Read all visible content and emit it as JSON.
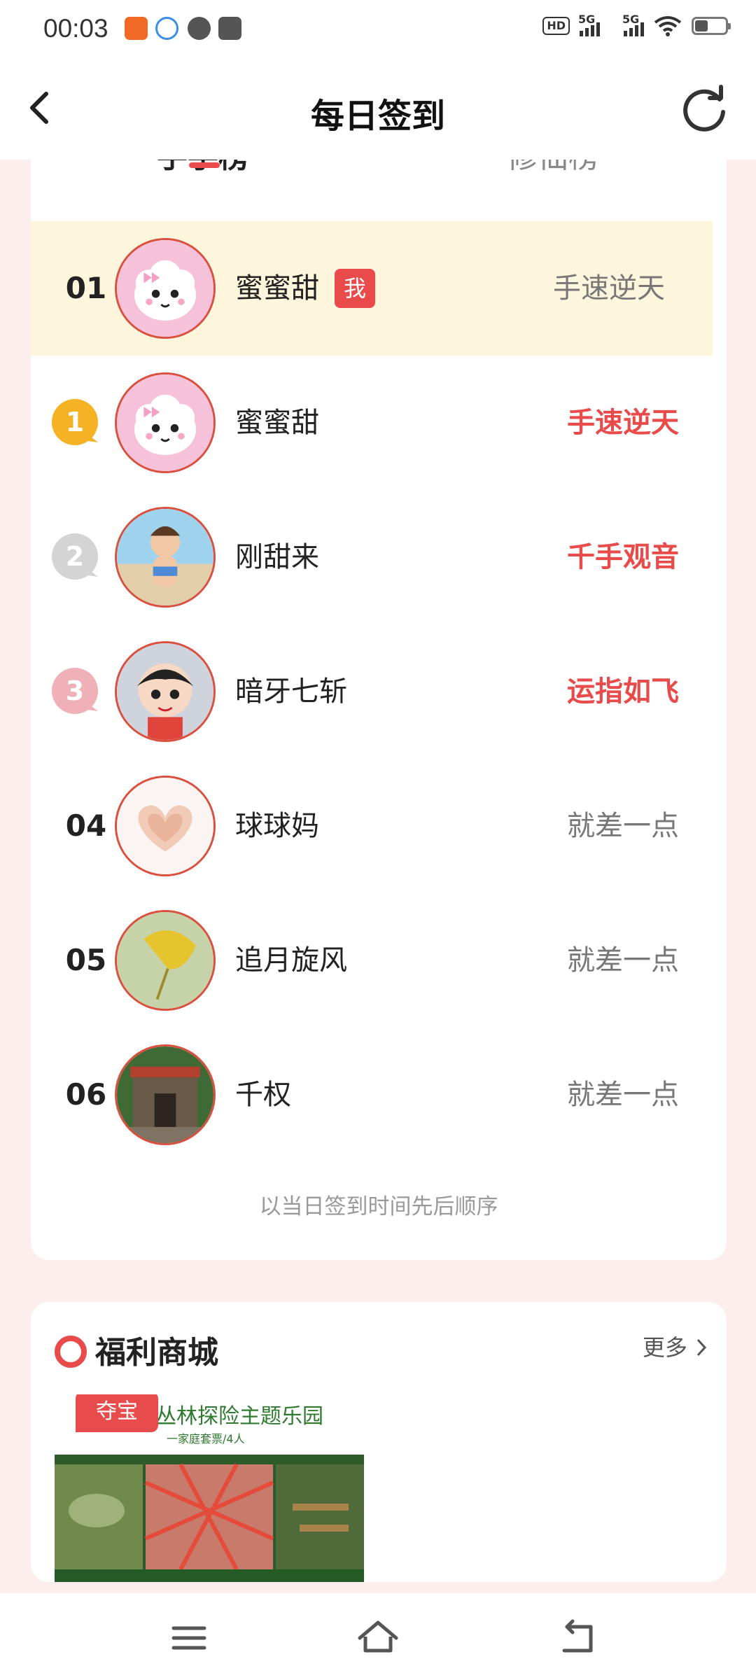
{
  "status_bar": {
    "time": "00:03",
    "icons": [
      "alipay-icon",
      "app-icon",
      "speedometer-icon",
      "gallery-icon"
    ],
    "right": {
      "hd": "HD",
      "hd_sub": "2",
      "sig1": "5G",
      "sig2": "5G",
      "battery_level": 0.4
    }
  },
  "header": {
    "title": "每日签到"
  },
  "tabs": [
    {
      "label": "手手榜"
    },
    {
      "label": "修仙榜"
    }
  ],
  "ranking": [
    {
      "rank": "01",
      "name": "蜜蜜甜",
      "badge": "我",
      "result": "手速逆天",
      "highlight": false,
      "avatar": "cloud"
    },
    {
      "rank": "1",
      "name": "蜜蜜甜",
      "result": "手速逆天",
      "highlight": true,
      "avatar": "cloud"
    },
    {
      "rank": "2",
      "name": "刚甜来",
      "result": "千手观音",
      "highlight": true,
      "avatar": "child"
    },
    {
      "rank": "3",
      "name": "暗牙七斩",
      "result": "运指如飞",
      "highlight": true,
      "avatar": "cartoon"
    },
    {
      "rank": "04",
      "name": "球球妈",
      "result": "就差一点",
      "highlight": false,
      "avatar": "heart"
    },
    {
      "rank": "05",
      "name": "追月旋风",
      "result": "就差一点",
      "highlight": false,
      "avatar": "leaf"
    },
    {
      "rank": "06",
      "name": "千权",
      "result": "就差一点",
      "highlight": false,
      "avatar": "house"
    }
  ],
  "footnote": "以当日签到时间先后顺序",
  "mall": {
    "title": "福利商城",
    "more": "更多",
    "product": {
      "tag": "夺宝",
      "name": "丛林探险主题乐园",
      "subtitle": "一家庭套票/4人"
    }
  },
  "colors": {
    "accent": "#e94b4b",
    "gold": "#f5b224",
    "silver": "#cfcfcf",
    "bronze": "#efb0b8",
    "highlight_row": "#fdf6dc"
  }
}
